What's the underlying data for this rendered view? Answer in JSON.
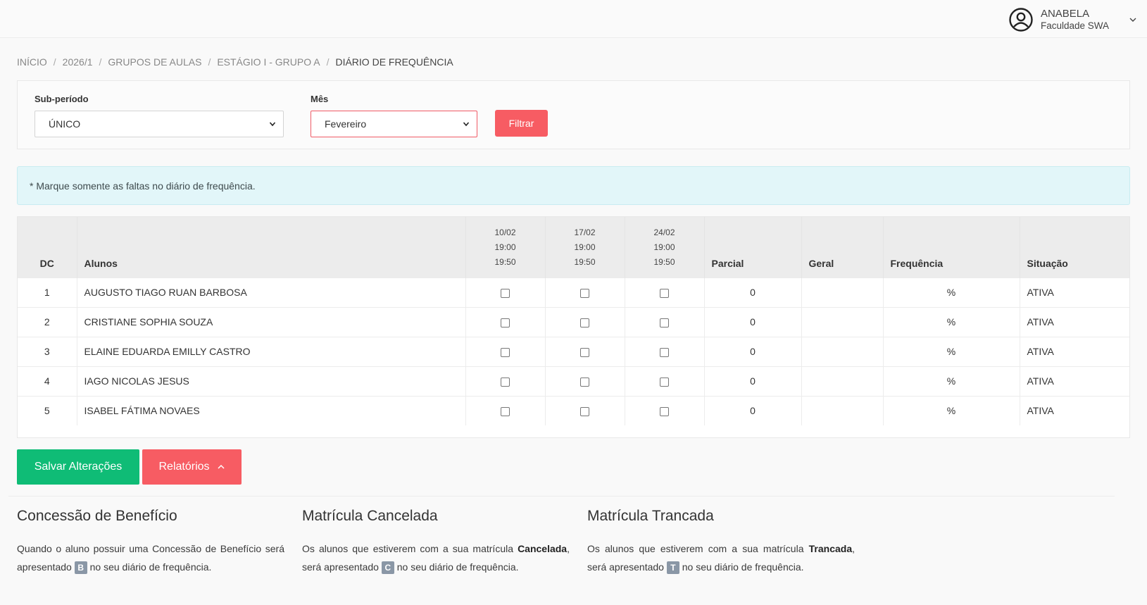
{
  "user": {
    "name": "ANABELA",
    "org": "Faculdade SWA"
  },
  "breadcrumb": [
    {
      "label": "INÍCIO"
    },
    {
      "label": "2026/1"
    },
    {
      "label": "GRUPOS DE AULAS"
    },
    {
      "label": "ESTÁGIO I - GRUPO A"
    },
    {
      "label": "DIÁRIO DE FREQUÊNCIA"
    }
  ],
  "filters": {
    "subperiod": {
      "label": "Sub-período",
      "value": "ÚNICO"
    },
    "month": {
      "label": "Mês",
      "value": "Fevereiro"
    },
    "button": "Filtrar"
  },
  "alert": "* Marque somente as faltas no diário de frequência.",
  "table": {
    "headers": {
      "dc": "DC",
      "students": "Alunos",
      "partial": "Parcial",
      "general": "Geral",
      "frequency": "Frequência",
      "status": "Situação"
    },
    "dates": [
      {
        "date": "10/02",
        "start": "19:00",
        "end": "19:50"
      },
      {
        "date": "17/02",
        "start": "19:00",
        "end": "19:50"
      },
      {
        "date": "24/02",
        "start": "19:00",
        "end": "19:50"
      }
    ],
    "rows": [
      {
        "dc": "1",
        "name": "AUGUSTO TIAGO RUAN BARBOSA",
        "partial": "0",
        "general": "",
        "frequency": "%",
        "status": "ATIVA"
      },
      {
        "dc": "2",
        "name": "CRISTIANE SOPHIA SOUZA",
        "partial": "0",
        "general": "",
        "frequency": "%",
        "status": "ATIVA"
      },
      {
        "dc": "3",
        "name": "ELAINE EDUARDA EMILLY CASTRO",
        "partial": "0",
        "general": "",
        "frequency": "%",
        "status": "ATIVA"
      },
      {
        "dc": "4",
        "name": "IAGO NICOLAS JESUS",
        "partial": "0",
        "general": "",
        "frequency": "%",
        "status": "ATIVA"
      },
      {
        "dc": "5",
        "name": "ISABEL FÁTIMA NOVAES",
        "partial": "0",
        "general": "",
        "frequency": "%",
        "status": "ATIVA"
      }
    ]
  },
  "actions": {
    "save": "Salvar Alterações",
    "reports": "Relatórios"
  },
  "legend": {
    "benefit": {
      "title": "Concessão de Benefício",
      "text_before": "Quando o aluno possuir uma Concessão de Benefício será apresentado",
      "badge": "B",
      "text_after": "no seu diário de frequência."
    },
    "cancelled": {
      "title": "Matrícula Cancelada",
      "text_before": "Os alunos que estiverem com a sua matrícula",
      "strong": "Cancelada",
      "text_mid": ", será apresentado",
      "badge": "C",
      "text_after": "no seu diário de frequência."
    },
    "locked": {
      "title": "Matrícula Trancada",
      "text_before": "Os alunos que estiverem com a sua matrícula",
      "strong": "Trancada",
      "text_mid": ", será apresentado",
      "badge": "T",
      "text_after": "no seu diário de frequência."
    }
  },
  "colors": {
    "primary_red": "#f75c63",
    "save_green": "#0fbc76",
    "alert_bg": "#e2f6f9",
    "badge_gray": "#8a97a6"
  }
}
